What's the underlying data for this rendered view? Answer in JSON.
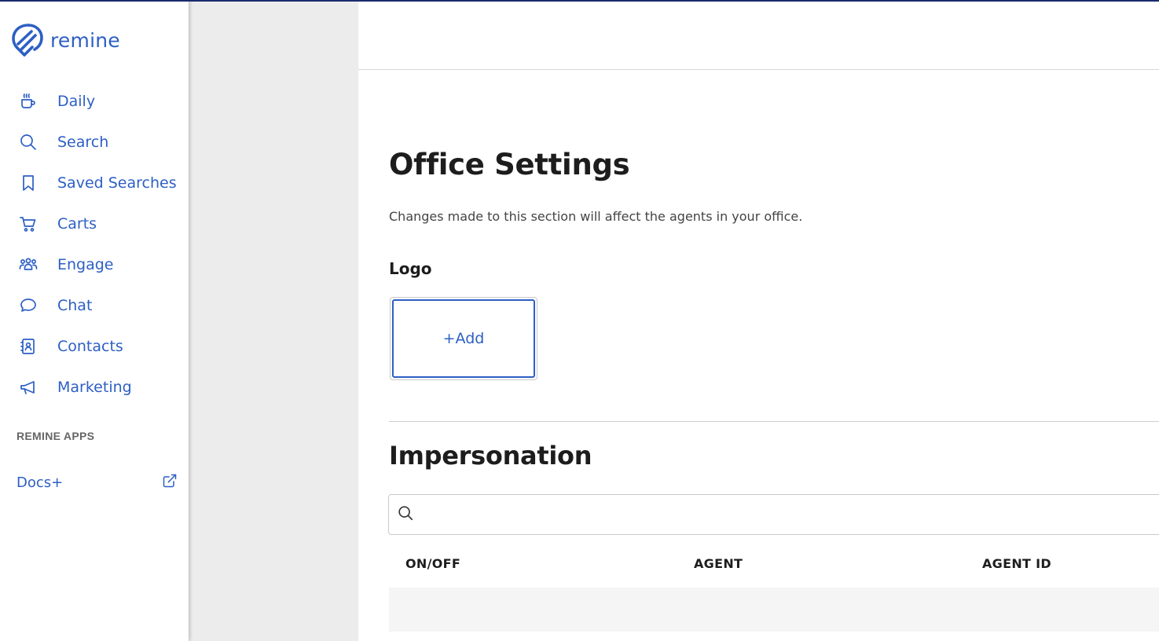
{
  "brand": {
    "name": "remine",
    "color": "#2d5fc4"
  },
  "nav": {
    "items": [
      {
        "label": "Daily",
        "icon": "coffee-cup-icon"
      },
      {
        "label": "Search",
        "icon": "search-icon"
      },
      {
        "label": "Saved Searches",
        "icon": "bookmark-icon"
      },
      {
        "label": "Carts",
        "icon": "cart-icon"
      },
      {
        "label": "Engage",
        "icon": "group-icon"
      },
      {
        "label": "Chat",
        "icon": "chat-bubble-icon"
      },
      {
        "label": "Contacts",
        "icon": "contact-book-icon"
      },
      {
        "label": "Marketing",
        "icon": "megaphone-icon"
      }
    ],
    "apps_heading": "REMINE APPS",
    "apps": [
      {
        "label": "Docs+",
        "icon": "external-link-icon"
      }
    ]
  },
  "main": {
    "title": "Office Settings",
    "description": "Changes made to this section will affect the agents in your office.",
    "logo": {
      "heading": "Logo",
      "add_label": "+Add"
    },
    "impersonation": {
      "title": "Impersonation",
      "search": {
        "value": "",
        "placeholder": ""
      },
      "columns": [
        "ON/OFF",
        "AGENT",
        "AGENT ID"
      ],
      "rows": []
    }
  }
}
